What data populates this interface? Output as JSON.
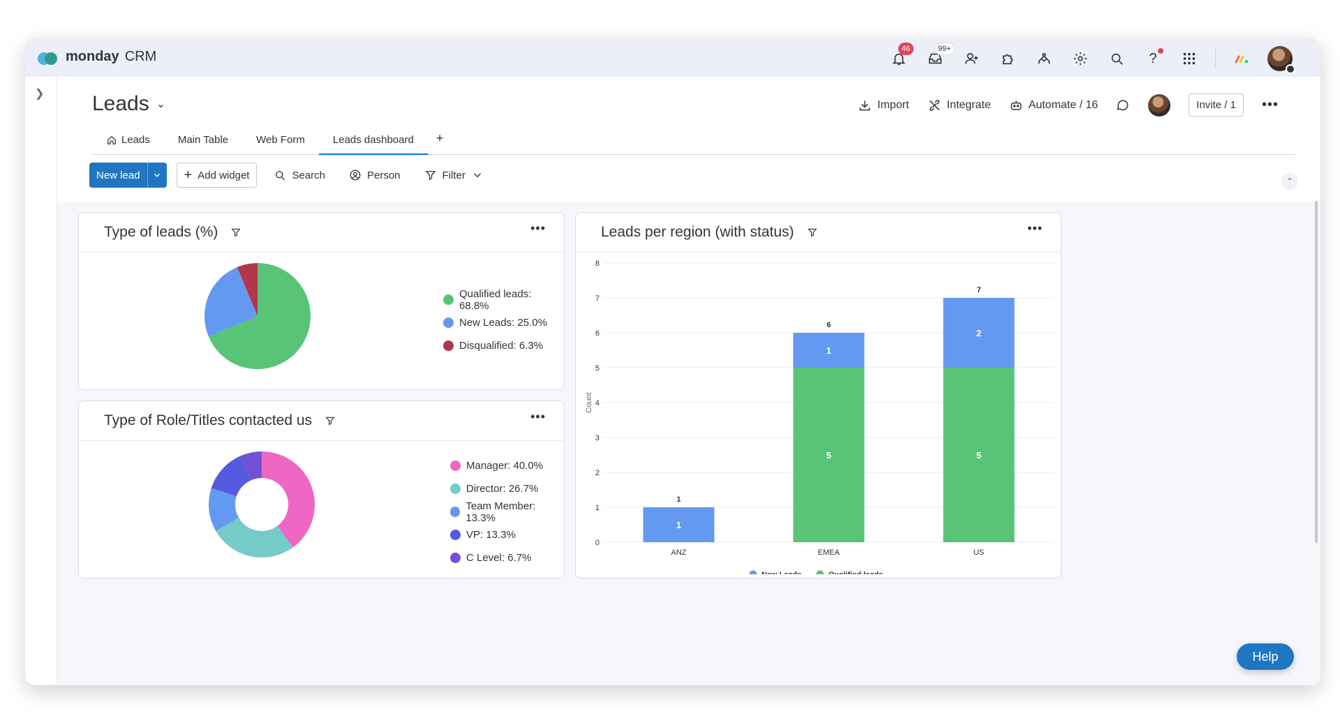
{
  "app": {
    "brand_main": "monday",
    "brand_sub": "CRM"
  },
  "topbar": {
    "notifications_badge": "46",
    "inbox_badge": "99+"
  },
  "board": {
    "title": "Leads",
    "actions": {
      "import": "Import",
      "integrate": "Integrate",
      "automate": "Automate / 16",
      "invite": "Invite / 1"
    },
    "tabs": [
      "Leads",
      "Main Table",
      "Web Form",
      "Leads dashboard"
    ],
    "active_tab": "Leads dashboard",
    "add_tab": "+"
  },
  "toolbar": {
    "new_lead": "New lead",
    "add_widget": "Add widget",
    "search": "Search",
    "person": "Person",
    "filter": "Filter"
  },
  "widgets": {
    "type_of_leads": {
      "title": "Type of leads (%)",
      "legend": [
        "Qualified leads: 68.8%",
        "New Leads: 25.0%",
        "Disqualified: 6.3%"
      ]
    },
    "roles": {
      "title": "Type of Role/Titles contacted us",
      "legend": [
        "Manager: 40.0%",
        "Director: 26.7%",
        "Team Member: 13.3%",
        "VP: 13.3%",
        "C Level: 6.7%"
      ]
    },
    "region": {
      "title": "Leads per region (with status)",
      "legend": [
        "New Leads",
        "Qualified leads"
      ]
    }
  },
  "help_button": "Help",
  "colors": {
    "qualified": "#57c478",
    "new_leads": "#6499f2",
    "disqualified": "#b2374d",
    "manager": "#ee67c3",
    "director": "#74cbc8",
    "team_member": "#6499f2",
    "vp": "#5559df",
    "c_level": "#7350d6",
    "primary": "#1f76c2"
  },
  "chart_data": [
    {
      "type": "pie",
      "title": "Type of leads (%)",
      "categories": [
        "Qualified leads",
        "New Leads",
        "Disqualified"
      ],
      "values": [
        68.8,
        25.0,
        6.3
      ]
    },
    {
      "type": "pie",
      "title": "Type of Role/Titles contacted us",
      "donut": true,
      "categories": [
        "Manager",
        "Director",
        "Team Member",
        "VP",
        "C Level"
      ],
      "values": [
        40.0,
        26.7,
        13.3,
        13.3,
        6.7
      ]
    },
    {
      "type": "bar",
      "stacked": true,
      "title": "Leads per region (with status)",
      "categories": [
        "ANZ",
        "EMEA",
        "US"
      ],
      "series": [
        {
          "name": "Qualified leads",
          "values": [
            0,
            5,
            5
          ]
        },
        {
          "name": "New Leads",
          "values": [
            1,
            1,
            2
          ]
        }
      ],
      "totals": [
        1,
        6,
        7
      ],
      "ylabel": "Count",
      "ylim": [
        0,
        8
      ],
      "yticks": [
        0,
        1,
        2,
        3,
        4,
        5,
        6,
        7,
        8
      ],
      "grid": true,
      "legend": "bottom"
    }
  ]
}
